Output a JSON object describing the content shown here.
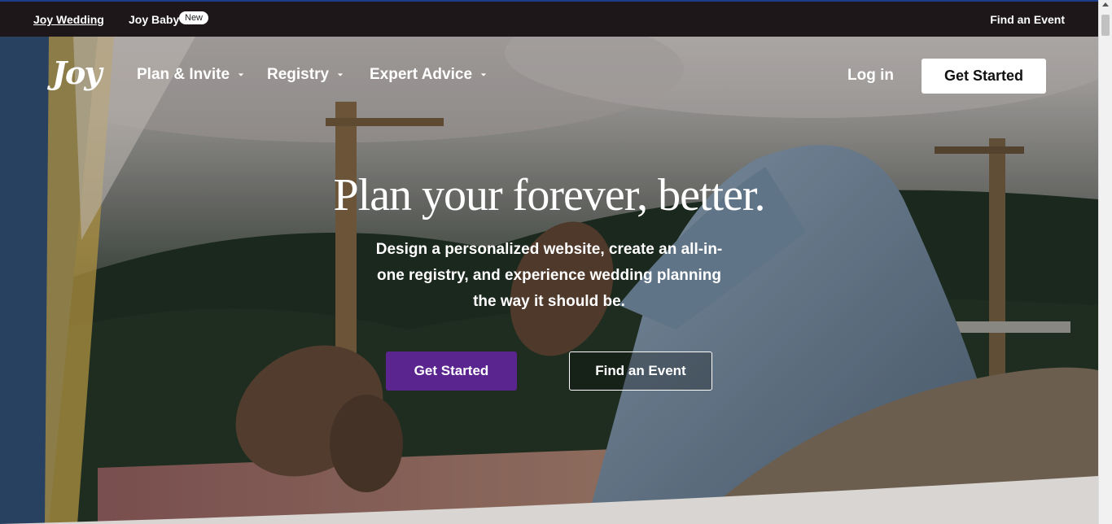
{
  "topbar": {
    "wedding_label": "Joy Wedding",
    "baby_label": "Joy Baby",
    "baby_badge": "New",
    "find_event_label": "Find an Event"
  },
  "nav": {
    "logo": "Joy",
    "items": [
      {
        "label": "Plan & Invite"
      },
      {
        "label": "Registry"
      },
      {
        "label": "Expert Advice"
      }
    ],
    "login_label": "Log in",
    "cta_label": "Get Started"
  },
  "hero": {
    "headline": "Plan your forever, better.",
    "subtext": "Design a personalized website, create an all-in-one registry, and experience wedding planning the way it should be.",
    "primary_cta": "Get Started",
    "secondary_cta": "Find an Event"
  },
  "colors": {
    "primary": "#5b2590",
    "topbar_bg": "#1d1719",
    "text_on_dark": "#ffffff"
  },
  "icons": [
    "chevron-down-icon"
  ]
}
